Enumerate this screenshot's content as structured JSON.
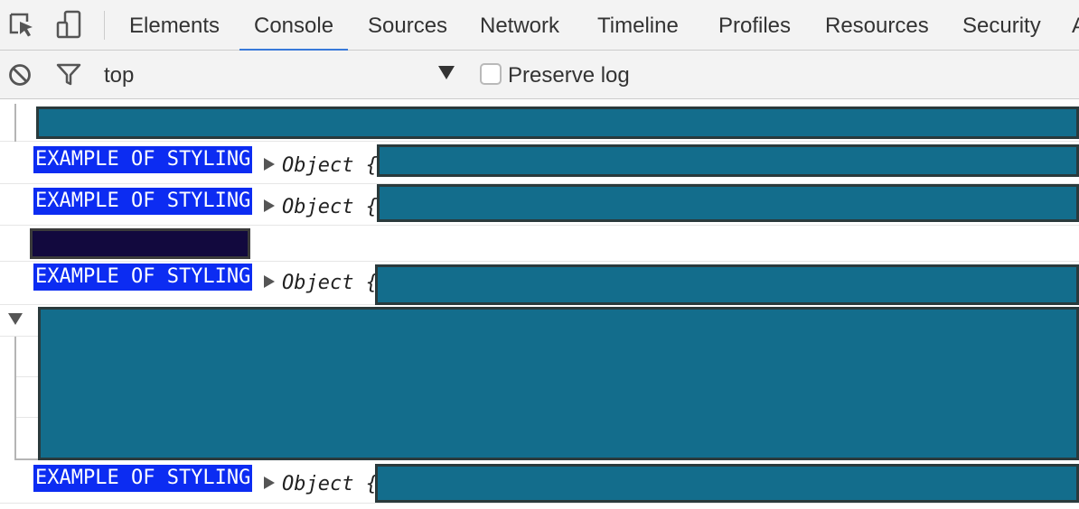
{
  "tabbar": {
    "tabs": [
      {
        "label": "Elements"
      },
      {
        "label": "Console",
        "selected": true
      },
      {
        "label": "Sources"
      },
      {
        "label": "Network"
      },
      {
        "label": "Timeline"
      },
      {
        "label": "Profiles"
      },
      {
        "label": "Resources"
      },
      {
        "label": "Security"
      }
    ],
    "icons": [
      "inspect-element-icon",
      "device-mode-icon"
    ]
  },
  "toolbar": {
    "context": "top",
    "preserve_log_label": "Preserve log",
    "preserve_log_checked": false,
    "icons": [
      "clear-console-icon",
      "filter-icon",
      "dropdown-arrow-icon"
    ]
  },
  "messages": {
    "styled_label": "EXAMPLE OF STYLING",
    "object_text": "Object {"
  },
  "colors": {
    "accent": "#3879d9",
    "styled_bg": "#0c2cf2",
    "redacted": "#136d8c",
    "redacted_dark": "#12093e"
  }
}
